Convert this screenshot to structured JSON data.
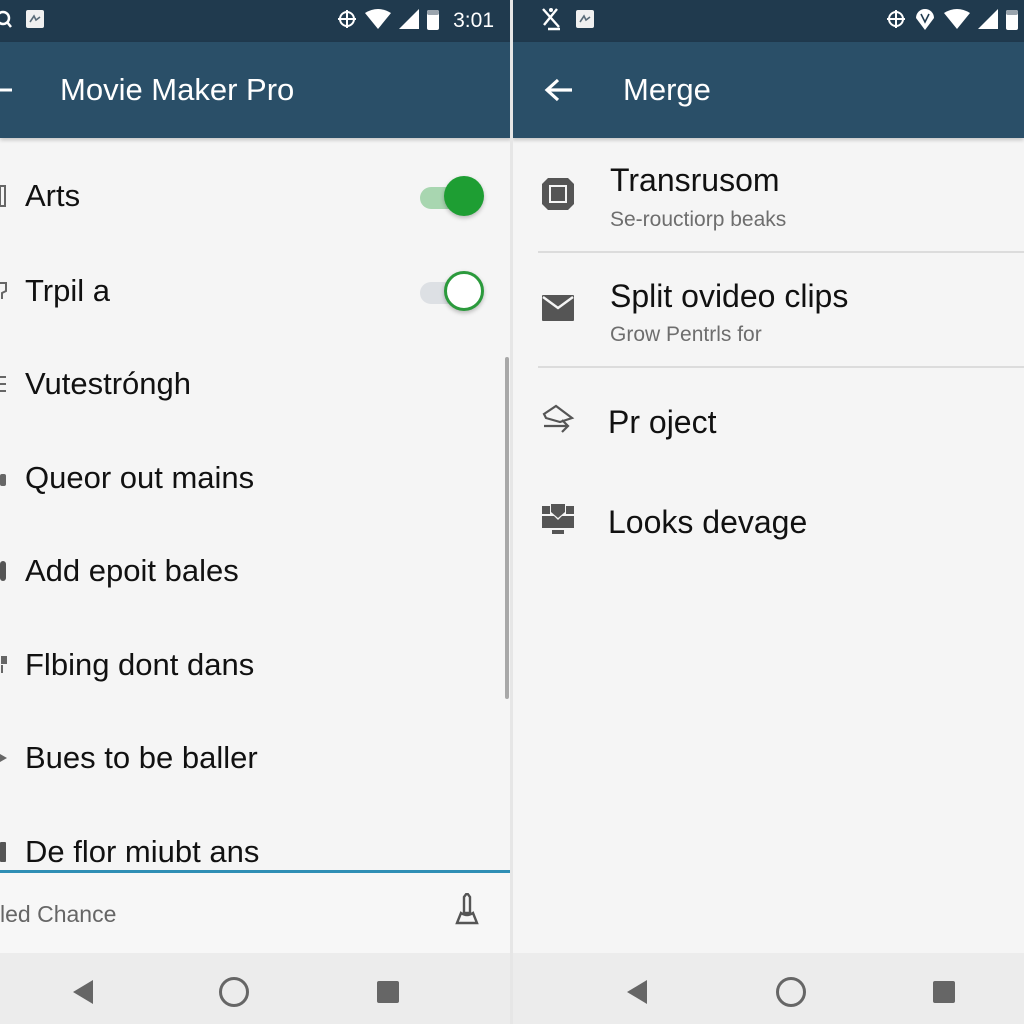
{
  "left_screen": {
    "status_bar": {
      "time": "3:01",
      "left_icons": [
        "search-icon",
        "photo-notification-icon"
      ],
      "right_icons": [
        "gps-icon",
        "wifi-icon",
        "cell-signal-icon",
        "battery-icon"
      ]
    },
    "app_bar": {
      "title": "Movie Maker  Pro",
      "nav_icon": "back-arrow-icon"
    },
    "items": [
      {
        "label": "Arts",
        "toggle": true,
        "toggle_on": true
      },
      {
        "label": "Trpil a",
        "toggle": true,
        "toggle_on": false
      },
      {
        "label": "Vutestróngh"
      },
      {
        "label": "Queor out mains"
      },
      {
        "label": "Add epoit bales"
      },
      {
        "label": "Flbing dont dans"
      },
      {
        "label": "Bues to be baller"
      },
      {
        "label": "De flor miubt ans"
      }
    ],
    "bottom_field": {
      "text": "led Chance",
      "icon": "pin-tool-icon"
    },
    "colors": {
      "switch_on": "#1e9e33",
      "switch_on_track": "#a8d6b0",
      "switch_off_track": "#dde0e4",
      "accent_line": "#2f8fb5"
    }
  },
  "right_screen": {
    "status_bar": {
      "left_icons": [
        "no-running-icon",
        "photo-notification-icon"
      ],
      "right_icons": [
        "gps-icon",
        "location-pin-icon",
        "wifi-icon",
        "cell-signal-icon",
        "battery-icon"
      ]
    },
    "app_bar": {
      "title": "Merge",
      "nav_icon": "back-arrow-icon"
    },
    "items": [
      {
        "title": "Transrusom",
        "subtitle": "Se-rouctiorp beaks",
        "icon": "stop-square-icon"
      },
      {
        "title": "Split ovideo clips",
        "subtitle": "Grow Pentrls for",
        "icon": "mail-icon"
      },
      {
        "title": "Pr oject",
        "icon": "share-arrow-icon"
      },
      {
        "title": "Looks devage",
        "icon": "inbox-tray-icon"
      }
    ]
  },
  "nav_bar": {
    "back": "back-triangle-icon",
    "home": "home-circle-icon",
    "recents": "recents-square-icon"
  }
}
